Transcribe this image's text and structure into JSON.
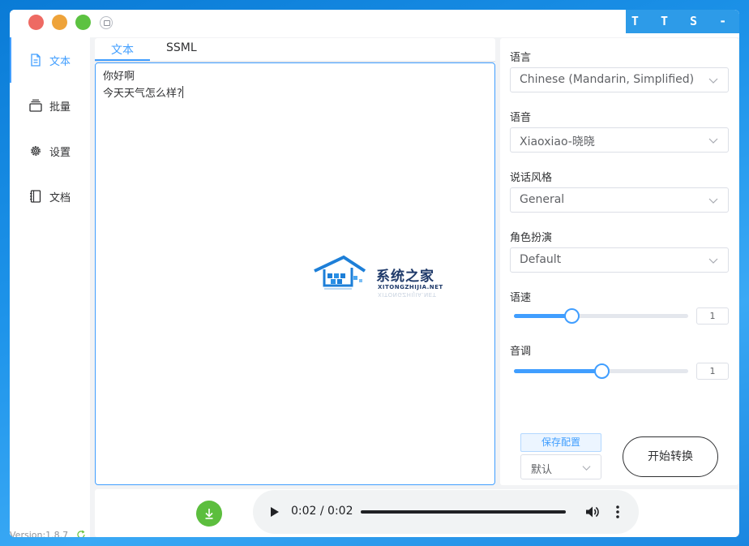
{
  "window": {
    "brand": "T T S - V U E",
    "version": "Version:1.8.7"
  },
  "sidebar": {
    "items": [
      {
        "label": "文本",
        "icon": "document-icon",
        "active": true
      },
      {
        "label": "批量",
        "icon": "layers-icon",
        "active": false
      },
      {
        "label": "设置",
        "icon": "gear-icon",
        "active": false
      },
      {
        "label": "文档",
        "icon": "notebook-icon",
        "active": false
      }
    ]
  },
  "editor": {
    "tabs": [
      "文本",
      "SSML"
    ],
    "active_tab": "文本",
    "lines": [
      "你好啊",
      "今天天气怎么样?"
    ]
  },
  "watermark": {
    "title": "系统之家",
    "subtitle": "XITONGZHIJIA.NET"
  },
  "settings": {
    "language": {
      "label": "语言",
      "value": "Chinese (Mandarin, Simplified)"
    },
    "voice": {
      "label": "语音",
      "value": "Xiaoxiao-晓晓"
    },
    "style": {
      "label": "说话风格",
      "value": "General"
    },
    "role": {
      "label": "角色扮演",
      "value": "Default"
    },
    "rate": {
      "label": "语速",
      "value": "1",
      "slider_fraction": 0.33
    },
    "pitch": {
      "label": "音调",
      "value": "1",
      "slider_fraction": 0.5
    },
    "save_button": "保存配置",
    "preset_value": "默认",
    "start_button": "开始转换"
  },
  "player": {
    "time": "0:02 / 0:02"
  },
  "colors": {
    "accent": "#409eff",
    "download": "#5cbe3e",
    "brand_bg": "#2d9be8"
  }
}
